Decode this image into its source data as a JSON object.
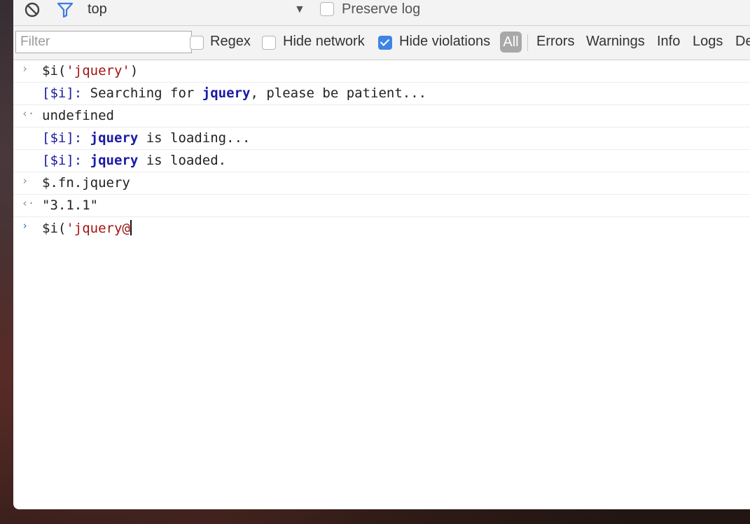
{
  "toolbar": {
    "clear_icon": "clear-console-icon",
    "filter_icon": "filter-icon",
    "context": "top",
    "context_arrow": "▼",
    "preserve_log": "Preserve log"
  },
  "filterbar": {
    "filter_placeholder": "Filter",
    "regex": "Regex",
    "hide_network": "Hide network",
    "hide_violations": "Hide violations",
    "levels": {
      "all": "All",
      "errors": "Errors",
      "warnings": "Warnings",
      "info": "Info",
      "logs": "Logs",
      "debug": "De"
    }
  },
  "console": {
    "entries": [
      {
        "prompt": "›",
        "code_prefix": "$i(",
        "code_string": "'jquery'",
        "code_suffix": ")"
      },
      {
        "tag": "[$i]:",
        "before": " Searching for ",
        "keyword": "jquery",
        "after": ", please be patient..."
      },
      {
        "prompt": "‹·",
        "result": "undefined"
      },
      {
        "tag": "[$i]:",
        "before": " ",
        "keyword": "jquery",
        "after": " is loading..."
      },
      {
        "tag": "[$i]:",
        "before": " ",
        "keyword": "jquery",
        "after": " is loaded."
      },
      {
        "prompt": "›",
        "code": "$.fn.jquery"
      },
      {
        "prompt": "‹·",
        "result_string": "\"3.1.1\""
      },
      {
        "prompt": "›",
        "input_prefix": "$i(",
        "input_string": "'jquery@"
      }
    ]
  },
  "colors": {
    "log_tag": "#1a1aa6",
    "string": "#a31515",
    "checkbox_checked": "#3e84e6",
    "prompt_active": "#2f6fe0"
  }
}
